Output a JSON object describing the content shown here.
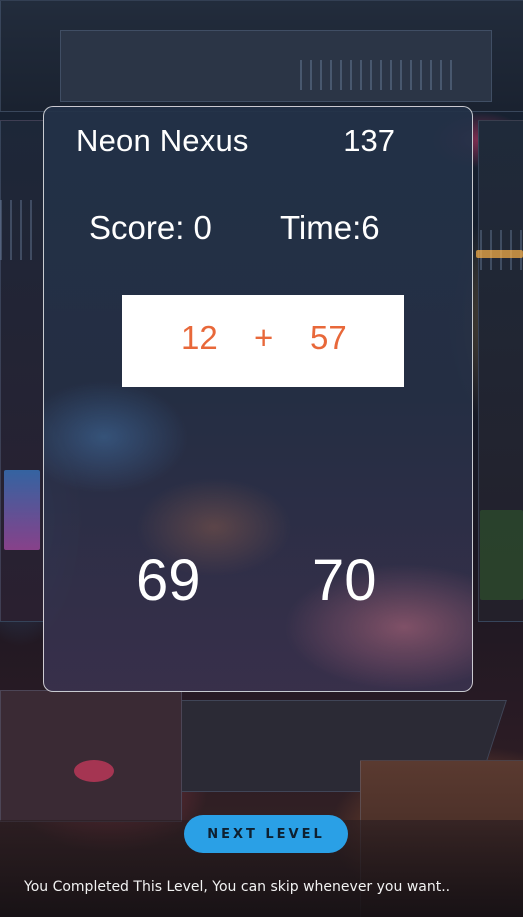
{
  "game": {
    "title": "Neon Nexus",
    "level_number": "137",
    "score_label": "Score: 0",
    "time_label": "Time:6"
  },
  "equation": {
    "left": "12",
    "operator": "+",
    "right": "57"
  },
  "answers": [
    "69",
    "70"
  ],
  "actions": {
    "next_level_label": "NEXT LEVEL"
  },
  "footer": {
    "message": "You Completed This Level, You can skip whenever you want.."
  },
  "colors": {
    "accent_button": "#2aa0e6",
    "equation_text": "#e8683a",
    "card_border": "#ffffff"
  }
}
